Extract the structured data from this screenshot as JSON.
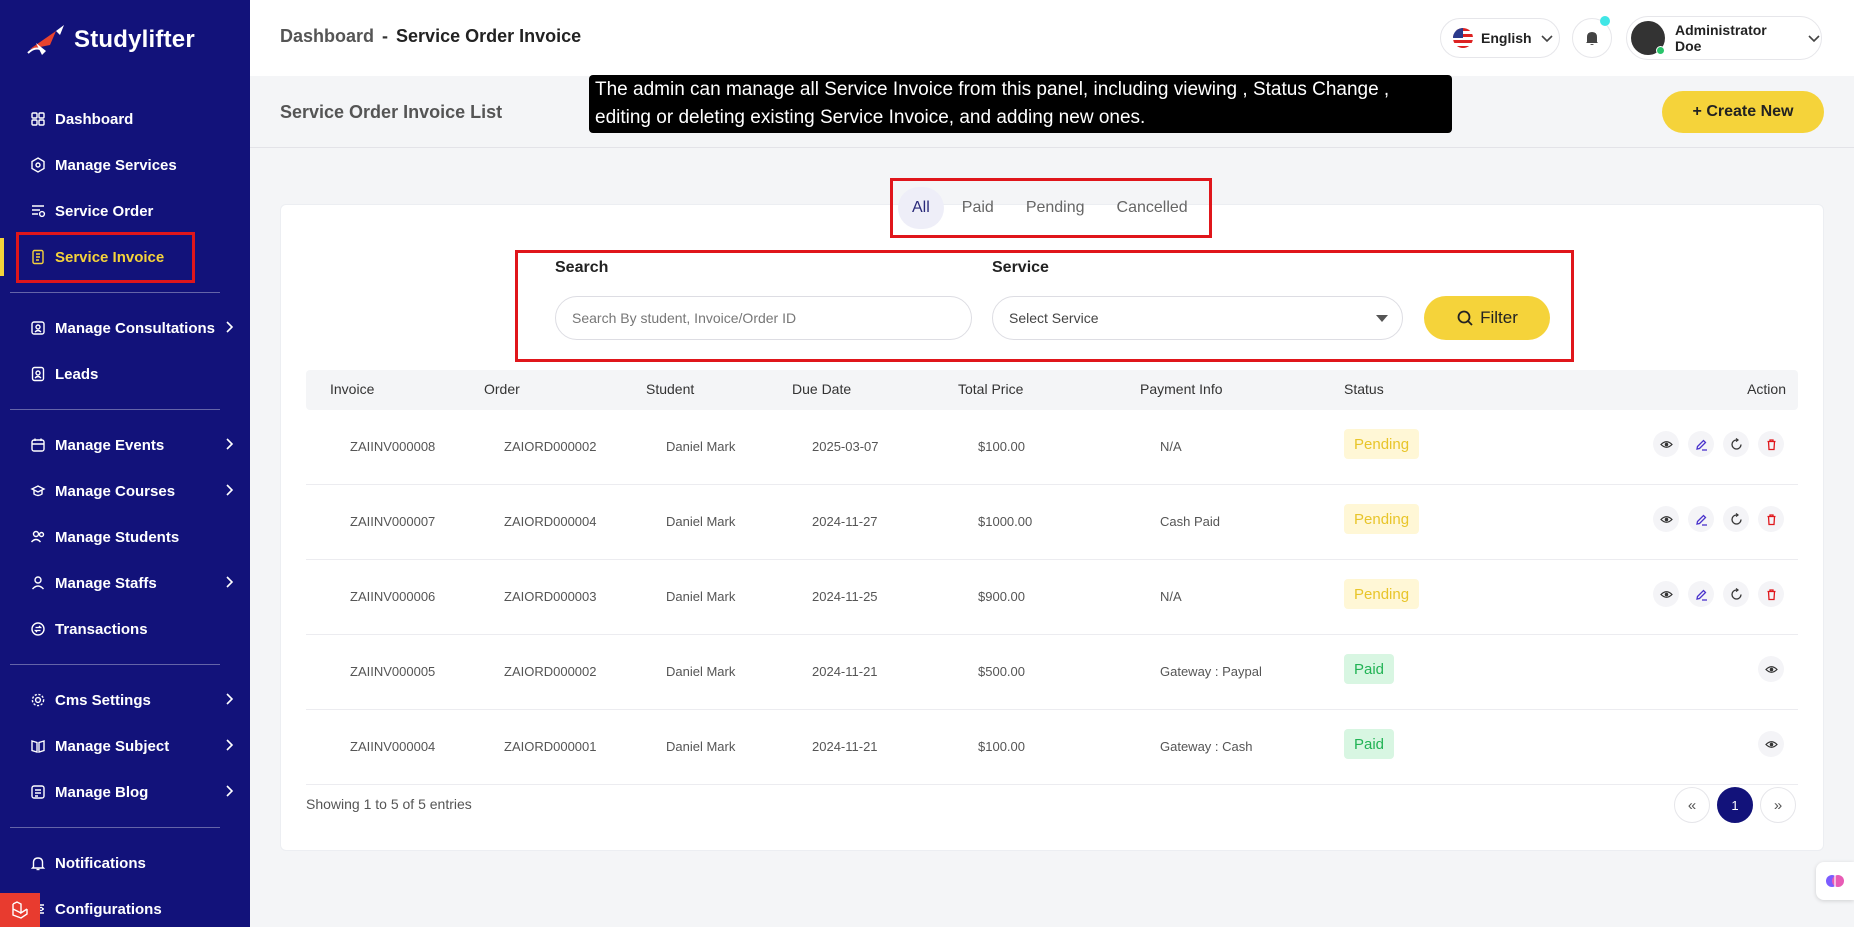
{
  "brand": {
    "name": "Studylifter"
  },
  "sidebar": {
    "items": [
      {
        "label": "Dashboard",
        "icon": "dashboard-icon"
      },
      {
        "label": "Manage Services",
        "icon": "services-icon"
      },
      {
        "label": "Service Order",
        "icon": "order-icon"
      },
      {
        "label": "Service Invoice",
        "icon": "invoice-icon",
        "active": true
      },
      {
        "label": "Manage Consultations",
        "icon": "consultation-icon",
        "submenu": true
      },
      {
        "label": "Leads",
        "icon": "leads-icon"
      },
      {
        "label": "Manage Events",
        "icon": "calendar-icon",
        "submenu": true
      },
      {
        "label": "Manage Courses",
        "icon": "courses-icon",
        "submenu": true
      },
      {
        "label": "Manage Students",
        "icon": "students-icon"
      },
      {
        "label": "Manage Staffs",
        "icon": "staff-icon",
        "submenu": true
      },
      {
        "label": "Transactions",
        "icon": "transactions-icon"
      },
      {
        "label": "Cms Settings",
        "icon": "settings-icon",
        "submenu": true
      },
      {
        "label": "Manage Subject",
        "icon": "subject-icon",
        "submenu": true
      },
      {
        "label": "Manage Blog",
        "icon": "blog-icon",
        "submenu": true
      },
      {
        "label": "Notifications",
        "icon": "bell-icon"
      },
      {
        "label": "Configurations",
        "icon": "config-icon"
      }
    ]
  },
  "header": {
    "breadcrumb_root": "Dashboard",
    "breadcrumb_sep": "-",
    "breadcrumb_current": "Service Order Invoice",
    "language": "English",
    "user_name": "Administrator Doe"
  },
  "subheader": {
    "title": "Service Order Invoice List",
    "create_label": "+ Create New"
  },
  "tooltip": "The admin can manage all Service Invoice from this panel, including viewing , Status Change , editing or deleting existing Service Invoice, and adding new ones.",
  "tabs": [
    "All",
    "Paid",
    "Pending",
    "Cancelled"
  ],
  "filters": {
    "search_label": "Search",
    "search_placeholder": "Search By student, Invoice/Order ID",
    "service_label": "Service",
    "service_value": "Select Service",
    "filter_label": "Filter"
  },
  "table": {
    "columns": [
      "Invoice",
      "Order",
      "Student",
      "Due Date",
      "Total Price",
      "Payment Info",
      "Status",
      "Action"
    ],
    "rows": [
      {
        "invoice": "ZAIINV000008",
        "order": "ZAIORD000002",
        "student": "Daniel Mark",
        "due": "2025-03-07",
        "price": "$100.00",
        "payment": "N/A",
        "status": "Pending"
      },
      {
        "invoice": "ZAIINV000007",
        "order": "ZAIORD000004",
        "student": "Daniel Mark",
        "due": "2024-11-27",
        "price": "$1000.00",
        "payment": "Cash Paid",
        "status": "Pending"
      },
      {
        "invoice": "ZAIINV000006",
        "order": "ZAIORD000003",
        "student": "Daniel Mark",
        "due": "2024-11-25",
        "price": "$900.00",
        "payment": "N/A",
        "status": "Pending"
      },
      {
        "invoice": "ZAIINV000005",
        "order": "ZAIORD000002",
        "student": "Daniel Mark",
        "due": "2024-11-21",
        "price": "$500.00",
        "payment": "Gateway : Paypal",
        "status": "Paid"
      },
      {
        "invoice": "ZAIINV000004",
        "order": "ZAIORD000001",
        "student": "Daniel Mark",
        "due": "2024-11-21",
        "price": "$100.00",
        "payment": "Gateway : Cash",
        "status": "Paid"
      }
    ]
  },
  "pagination": {
    "showing": "Showing 1 to 5 of 5 entries",
    "prev": "«",
    "current": "1",
    "next": "»"
  },
  "colors": {
    "sidebar_bg": "#12127a",
    "accent": "#f5d33a",
    "highlight_border": "#e0161b"
  }
}
